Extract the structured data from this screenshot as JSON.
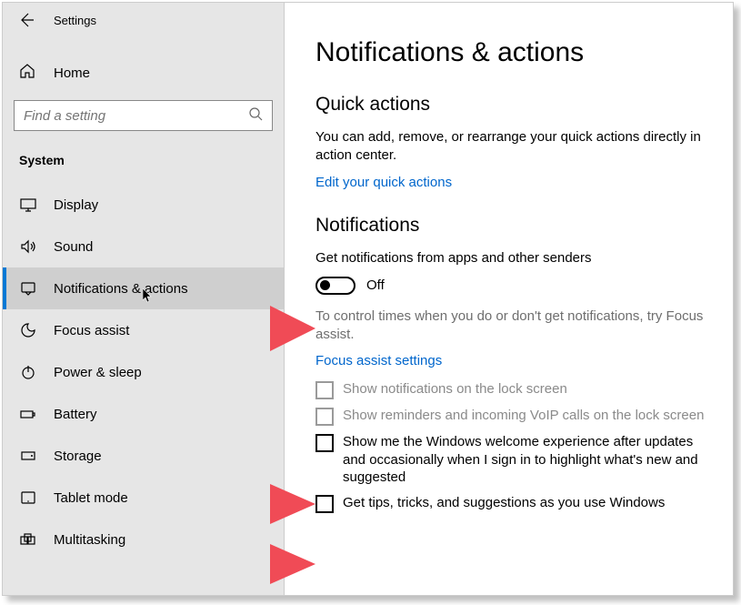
{
  "topbar": {
    "title": "Settings"
  },
  "home": {
    "label": "Home"
  },
  "search": {
    "placeholder": "Find a setting"
  },
  "category": "System",
  "nav": [
    {
      "label": "Display",
      "icon": "display"
    },
    {
      "label": "Sound",
      "icon": "sound"
    },
    {
      "label": "Notifications & actions",
      "icon": "notifications",
      "selected": true
    },
    {
      "label": "Focus assist",
      "icon": "focus"
    },
    {
      "label": "Power & sleep",
      "icon": "power"
    },
    {
      "label": "Battery",
      "icon": "battery"
    },
    {
      "label": "Storage",
      "icon": "storage"
    },
    {
      "label": "Tablet mode",
      "icon": "tablet"
    },
    {
      "label": "Multitasking",
      "icon": "multitask"
    }
  ],
  "page": {
    "title": "Notifications & actions",
    "quick": {
      "heading": "Quick actions",
      "desc": "You can add, remove, or rearrange your quick actions directly in action center.",
      "link": "Edit your quick actions"
    },
    "notifications": {
      "heading": "Notifications",
      "toggle_caption": "Get notifications from apps and other senders",
      "toggle_state": "Off",
      "control_text": "To control times when you do or don't get notifications, try Focus assist.",
      "focus_link": "Focus assist settings",
      "checks": [
        {
          "label": "Show notifications on the lock screen",
          "disabled": true
        },
        {
          "label": "Show reminders and incoming VoIP calls on the lock screen",
          "disabled": true
        },
        {
          "label": "Show me the Windows welcome experience after updates and occasionally when I sign in to highlight what's new and suggested",
          "disabled": false
        },
        {
          "label": "Get tips, tricks, and suggestions as you use Windows",
          "disabled": false
        }
      ]
    }
  },
  "colors": {
    "accent": "#0078d4",
    "link": "#0066cc",
    "arrow": "#f04b56"
  }
}
